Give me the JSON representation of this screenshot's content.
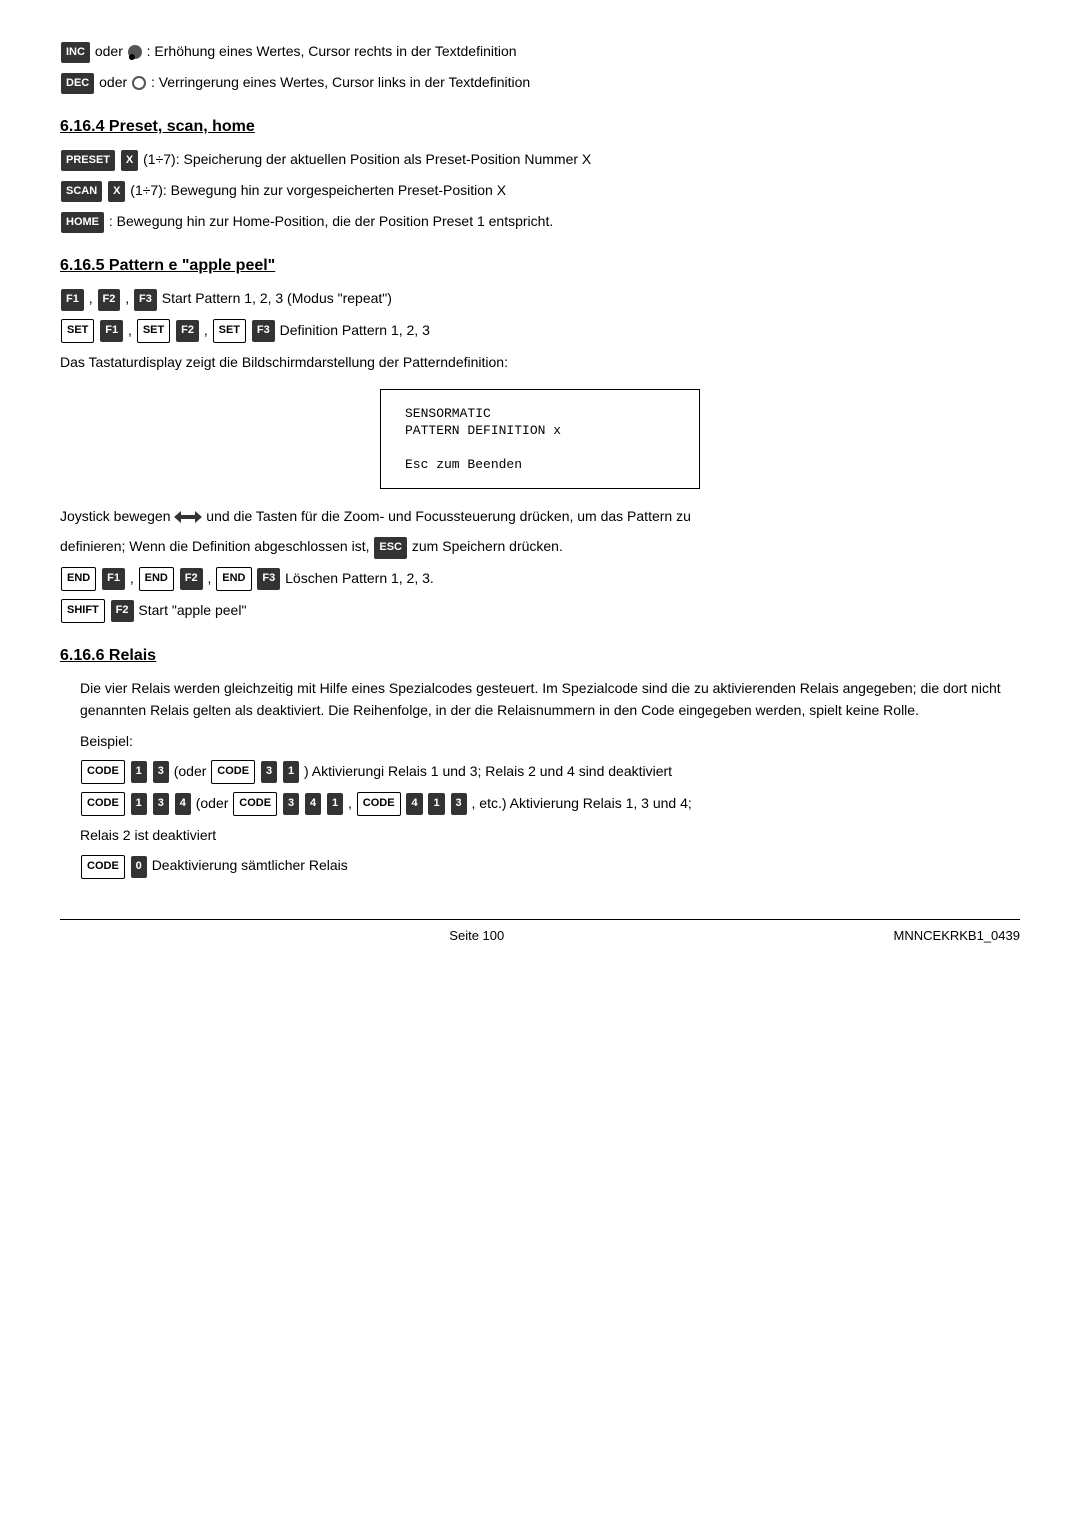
{
  "top_lines": [
    {
      "id": "inc_line",
      "key": "INC",
      "separator": "oder",
      "icon": "circle-filled",
      "text": ": Erhöhung eines Wertes, Cursor rechts in der Textdefinition"
    },
    {
      "id": "dec_line",
      "key": "DEC",
      "separator": "oder",
      "icon": "circle-outline",
      "text": ": Verringerung eines Wertes, Cursor links in der Textdefinition"
    }
  ],
  "section_preset": {
    "heading": "6.16.4 Preset, scan, home",
    "lines": [
      {
        "keys": [
          "PRESET",
          "X"
        ],
        "text": "(1÷7): Speicherung der aktuellen Position als Preset-Position Nummer X"
      },
      {
        "keys": [
          "SCAN",
          "X"
        ],
        "text": "(1÷7): Bewegung hin zur vorgespeicherten Preset-Position X"
      },
      {
        "keys": [
          "HOME"
        ],
        "text": ": Bewegung hin zur Home-Position, die der Position Preset 1 entspricht."
      }
    ]
  },
  "section_pattern": {
    "heading": "6.16.5 Pattern e \"apple peel\"",
    "f_keys_line1": {
      "keys": [
        "F1",
        "F2",
        "F3"
      ],
      "text": "Start Pattern 1, 2, 3 (Modus \"repeat\")"
    },
    "f_keys_line2": {
      "pairs": [
        [
          "SET",
          "F1"
        ],
        [
          "SET",
          "F2"
        ],
        [
          "SET",
          "F3"
        ]
      ],
      "text": "Definition Pattern 1, 2, 3"
    },
    "display_intro": "Das Tastaturdisplay zeigt die Bildschirmdarstellung der Patterndefinition:",
    "display_box": {
      "line1": "SENSORMATIC",
      "line2": "PATTERN DEFINITION x",
      "line3": "",
      "line4": "Esc zum Beenden"
    },
    "joystick_text1": "Joystick bewegen",
    "joystick_text2": "und die Tasten für die Zoom- und Focussteuerung drücken, um das Pattern zu",
    "joystick_text3": "definieren; Wenn die Definition abgeschlossen ist,",
    "esc_key": "ESC",
    "joystick_text4": "zum Speichern drücken.",
    "delete_line": {
      "pairs": [
        [
          "END",
          "F1"
        ],
        [
          "END",
          "F2"
        ],
        [
          "END",
          "F3"
        ]
      ],
      "text": "Löschen Pattern 1, 2, 3."
    },
    "shift_line": {
      "keys": [
        "SHIFT",
        "F2"
      ],
      "text": "Start \"apple peel\""
    }
  },
  "section_relais": {
    "heading": "6.16.6 Relais",
    "intro": "Die vier Relais werden gleichzeitig mit Hilfe eines Spezialcodes gesteuert. Im Spezialcode sind die zu aktivierenden Relais angegeben; die dort nicht genannten Relais gelten als deaktiviert. Die Reihenfolge, in der die Relaisnummern in den Code eingegeben werden, spielt keine Rolle.",
    "beispiel_label": "Beispiel:",
    "example1": {
      "keys1": [
        "CODE",
        "1",
        "3"
      ],
      "oder": "oder",
      "keys2": [
        "CODE",
        "3",
        "1"
      ],
      "text": "Aktivierungi Relais 1 und 3; Relais 2 und 4 sind deaktiviert"
    },
    "example2": {
      "keys1": [
        "CODE",
        "1",
        "3",
        "4"
      ],
      "oder1": "oder",
      "keys2": [
        "CODE",
        "3",
        "4",
        "1"
      ],
      "comma": ",",
      "keys3": [
        "CODE",
        "4",
        "1",
        "3"
      ],
      "etc_text": ", etc.) Aktivierung Relais 1, 3 und 4;",
      "line2": "Relais 2 ist deaktiviert"
    },
    "example3": {
      "keys": [
        "CODE",
        "0"
      ],
      "text": "Deaktivierung sämtlicher Relais"
    }
  },
  "footer": {
    "page": "Seite 100",
    "doc": "MNNCEKRKB1_0439"
  }
}
